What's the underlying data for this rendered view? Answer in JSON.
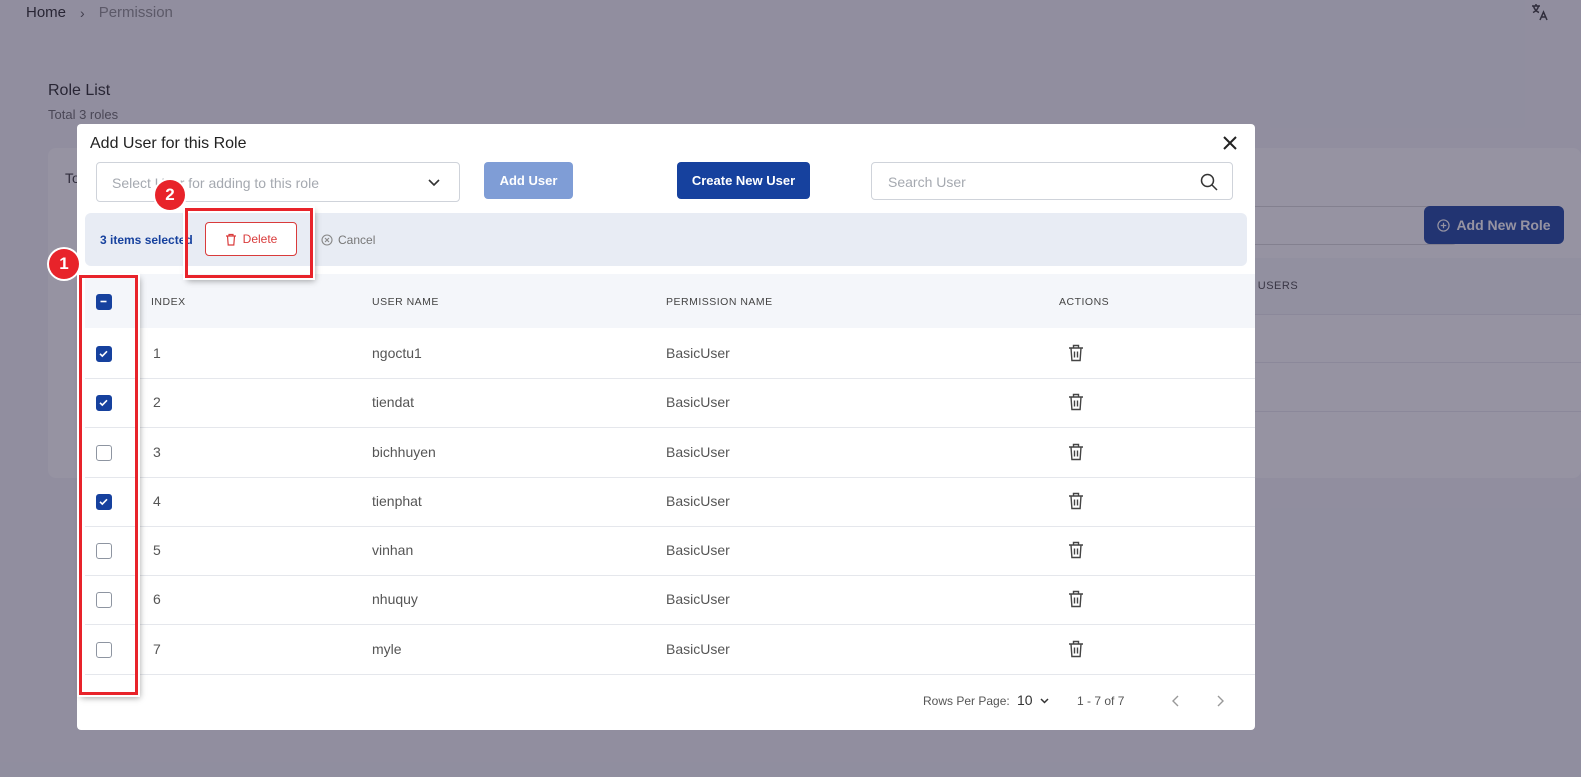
{
  "breadcrumb": {
    "home": "Home",
    "separator": "›",
    "current": "Permission"
  },
  "background": {
    "role_list_title": "Role List",
    "role_list_subtitle": "Total 3 roles",
    "card_peek_text": "To",
    "add_new_role_label": "Add New Role",
    "users_column_peek": "L USERS"
  },
  "modal": {
    "title": "Add User for this Role",
    "select_placeholder": "Select User for adding to this role",
    "add_user_label": "Add User",
    "create_new_user_label": "Create New User",
    "search_placeholder": "Search User",
    "selection": {
      "count_text": "3 items selected",
      "delete_label": "Delete",
      "cancel_label": "Cancel"
    },
    "columns": {
      "index": "INDEX",
      "user_name": "USER NAME",
      "permission_name": "PERMISSION NAME",
      "actions": "ACTIONS"
    },
    "rows": [
      {
        "index": "1",
        "user_name": "ngoctu1",
        "permission": "BasicUser",
        "checked": true
      },
      {
        "index": "2",
        "user_name": "tiendat",
        "permission": "BasicUser",
        "checked": true
      },
      {
        "index": "3",
        "user_name": "bichhuyen",
        "permission": "BasicUser",
        "checked": false
      },
      {
        "index": "4",
        "user_name": "tienphat",
        "permission": "BasicUser",
        "checked": true
      },
      {
        "index": "5",
        "user_name": "vinhan",
        "permission": "BasicUser",
        "checked": false
      },
      {
        "index": "6",
        "user_name": "nhuquy",
        "permission": "BasicUser",
        "checked": false
      },
      {
        "index": "7",
        "user_name": "myle",
        "permission": "BasicUser",
        "checked": false
      }
    ],
    "pagination": {
      "rows_per_page_label": "Rows Per Page:",
      "rows_per_page_value": "10",
      "range_text": "1 - 7 of 7"
    }
  },
  "annotations": [
    {
      "label": "1"
    },
    {
      "label": "2"
    }
  ],
  "colors": {
    "primary": "#16419e",
    "primary_disabled": "#7f9dd6",
    "danger": "#d93b3b",
    "annotation": "#e8232a"
  }
}
